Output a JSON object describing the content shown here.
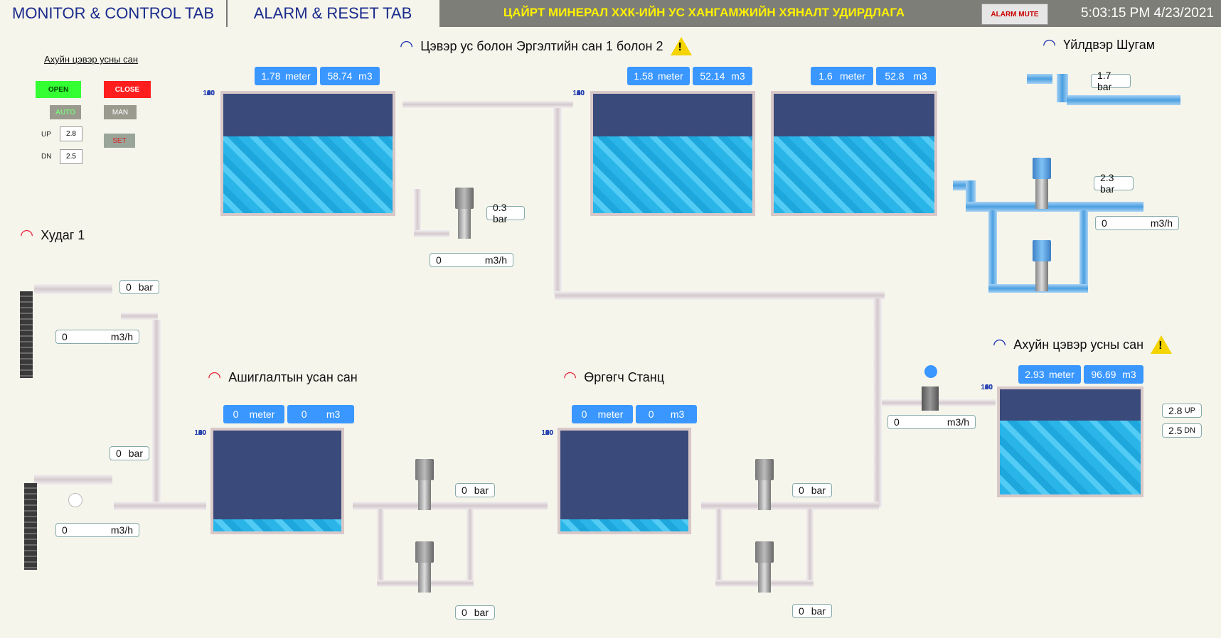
{
  "header": {
    "tab_monitor": "MONITOR & CONTROL TAB",
    "tab_alarm": "ALARM & RESET TAB",
    "title": "ЦАЙРТ МИНЕРАЛ ХХК-ИЙН УС ХАНГАМЖИЙН ХЯНАЛТ УДИРДЛАГА",
    "alarm_mute": "ALARM MUTE",
    "clock": "5:03:15 PM 4/23/2021"
  },
  "control_panel": {
    "title": "Ахуйн цэвэр усны сан",
    "open": "OPEN",
    "close": "CLOSE",
    "auto": "AUTO",
    "man": "MAN",
    "up_label": "UP",
    "up_value": "2.8",
    "dn_label": "DN",
    "dn_value": "2.5",
    "set": "SET"
  },
  "well": {
    "label": "Худаг 1",
    "top_pressure": "0",
    "top_flow": "0",
    "bottom_pressure": "0",
    "bottom_flow": "0"
  },
  "clean_tanks": {
    "label": "Цэвэр ус болон Эргэлтийн сан 1 болон 2",
    "tank1_level": "1.78",
    "tank1_volume": "58.74",
    "tank2_level": "1.58",
    "tank2_volume": "52.14",
    "tank3_level": "1.6",
    "tank3_volume": "52.8",
    "pump_pressure": "0.3 bar",
    "pump_flow": "0"
  },
  "factory_line": {
    "label": "Үйлдвэр Шугам",
    "pressure_top": "1.7 bar",
    "pressure_mid": "2.3 bar",
    "flow": "0"
  },
  "usage_tank": {
    "label": "Ашиглалтын усан сан",
    "level": "0",
    "volume": "0",
    "pressure_top": "0",
    "pressure_bottom": "0"
  },
  "pump_station": {
    "label": "Өргөгч Станц",
    "level": "0",
    "volume": "0",
    "pressure_top": "0",
    "pressure_bottom": "0"
  },
  "domestic_tank": {
    "label": "Ахуйн цэвэр усны сан",
    "level": "2.93",
    "volume": "96.69",
    "up_value": "2.8",
    "up_label": "UP",
    "dn_value": "2.5",
    "dn_label": "DN",
    "valve_flow": "0"
  },
  "units": {
    "meter": "meter",
    "m3": "m3",
    "bar": "bar",
    "m3h": "m3/h"
  },
  "axis_ticks": [
    "100",
    "80",
    "60",
    "40",
    "20",
    "0"
  ],
  "colors": {
    "header_bg": "#7d7e77",
    "title": "#fff200",
    "pill": "#3a97ff",
    "wifi_blue": "#1a2fb0",
    "wifi_red": "#e8283a",
    "water": "#2ab5e8"
  },
  "icons": {
    "wifi": "wifi-icon",
    "warning": "warning-icon"
  }
}
